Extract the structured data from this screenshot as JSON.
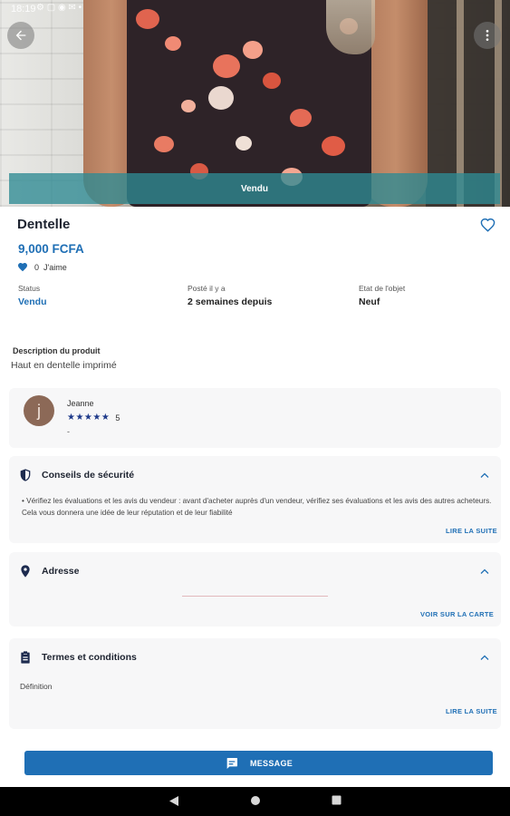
{
  "status_bar": {
    "time": "18:19",
    "icons": "⚙ ▢ ◉ ✉ •"
  },
  "hero": {
    "sold_banner": "Vendu"
  },
  "product": {
    "title": "Dentelle",
    "price": "9,000 FCFA",
    "likes_count": "0",
    "likes_label": "J'aime"
  },
  "meta": {
    "status_label": "Status",
    "status_value": "Vendu",
    "posted_label": "Posté il y a",
    "posted_value": "2 semaines depuis",
    "state_label": "Etat de l'objet",
    "state_value": "Neuf"
  },
  "description": {
    "label": "Description du produit",
    "text": "Haut en dentelle imprimé"
  },
  "seller": {
    "initial": "j",
    "name": "Jeanne",
    "stars": "★★★★★",
    "rating": "5",
    "subtitle": "-"
  },
  "safety": {
    "title": "Conseils de sécurité",
    "body": "• Vérifiez les évaluations et les avis du vendeur : avant d'acheter auprès d'un vendeur, vérifiez ses évaluations et les avis des autres acheteurs. Cela vous donnera une idée de leur réputation et de leur fiabilité",
    "link": "LIRE LA SUITE"
  },
  "address": {
    "title": "Adresse",
    "link": "VOIR SUR LA CARTE"
  },
  "terms": {
    "title": "Termes et conditions",
    "definition": "Définition",
    "link": "LIRE LA SUITE"
  },
  "message_button": {
    "label": "MESSAGE"
  },
  "colors": {
    "accent": "#1f6fb5",
    "sold_banner": "#2e8b94",
    "avatar": "#8c6957",
    "dark_icon": "#1d2b4f"
  }
}
